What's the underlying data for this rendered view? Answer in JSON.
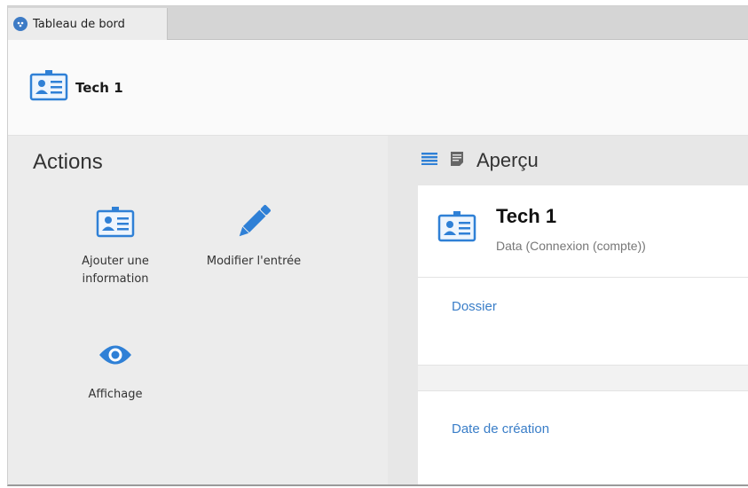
{
  "tab": {
    "label": "Tableau de bord",
    "icon": "dashboard-icon"
  },
  "header": {
    "title": "Tech 1",
    "icon": "contact-card-icon"
  },
  "actions": {
    "title": "Actions",
    "add_info": {
      "line1": "Ajouter une",
      "line2": "information",
      "icon": "contact-card-icon"
    },
    "edit_entry": {
      "label": "Modifier l'entrée",
      "icon": "pencil-icon"
    },
    "display": {
      "label": "Affichage",
      "icon": "eye-icon"
    }
  },
  "preview": {
    "title": "Aperçu",
    "icons": [
      "list-icon",
      "note-icon"
    ],
    "entry_title": "Tech 1",
    "entry_subtitle": "Data (Connexion (compte))",
    "fields": {
      "folder": "Dossier",
      "created": "Date de création"
    }
  },
  "colors": {
    "accent": "#3a7ec8",
    "icon_blue": "#2f80d6"
  }
}
